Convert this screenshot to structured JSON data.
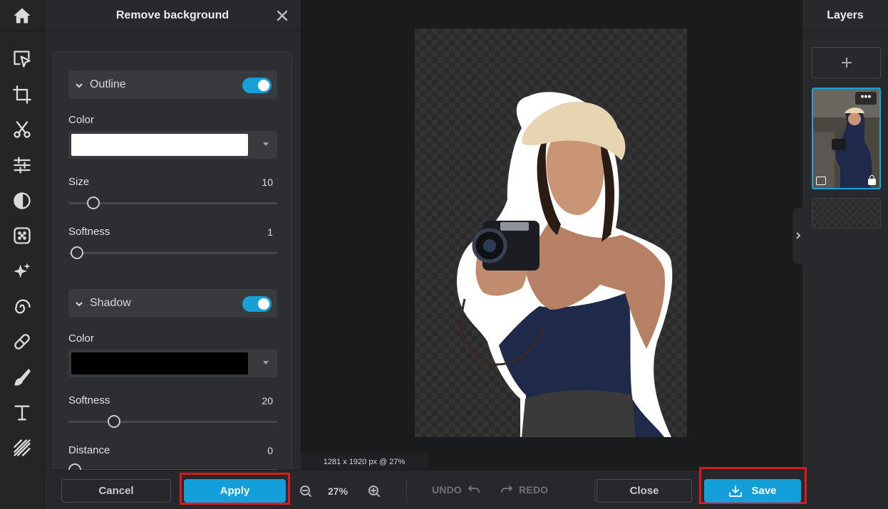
{
  "panel": {
    "title": "Remove background",
    "outline": {
      "label": "Outline",
      "enabled": true,
      "color_label": "Color",
      "color": "#ffffff",
      "size_label": "Size",
      "size_value": "10",
      "size_fraction": 0.12,
      "softness_label": "Softness",
      "softness_value": "1",
      "softness_fraction": 0.04
    },
    "shadow": {
      "label": "Shadow",
      "enabled": true,
      "color_label": "Color",
      "color": "#000000",
      "softness_label": "Softness",
      "softness_value": "20",
      "softness_fraction": 0.22,
      "distance_label": "Distance",
      "distance_value": "0",
      "distance_fraction": 0.03
    }
  },
  "canvas": {
    "size_info": "1281 x 1920 px @ 27%"
  },
  "layers": {
    "title": "Layers"
  },
  "bottom": {
    "cancel": "Cancel",
    "apply": "Apply",
    "zoom": "27%",
    "undo": "UNDO",
    "redo": "REDO",
    "close": "Close",
    "save": "Save"
  },
  "colors": {
    "accent": "#139fda",
    "highlight": "#d81c22"
  },
  "icons": [
    "home-icon",
    "select-icon",
    "crop-icon",
    "cut-icon",
    "adjust-icon",
    "filter-icon",
    "effects-icon",
    "magic-icon",
    "liquify-icon",
    "heal-icon",
    "brush-icon",
    "text-icon",
    "pattern-icon"
  ]
}
